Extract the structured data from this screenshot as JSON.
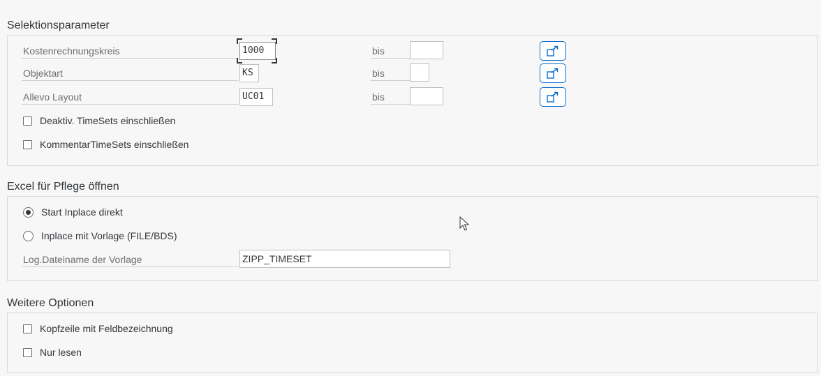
{
  "selection": {
    "title": "Selektionsparameter",
    "fields": [
      {
        "label": "Kostenrechnungskreis",
        "value": "1000",
        "bis": "bis",
        "to_value": ""
      },
      {
        "label": "Objektart",
        "value": "KS",
        "bis": "bis",
        "to_value": ""
      },
      {
        "label": "Allevo Layout",
        "value": "UC01",
        "bis": "bis",
        "to_value": ""
      }
    ],
    "checkboxes": [
      {
        "label": "Deaktiv. TimeSets einschließen",
        "checked": false
      },
      {
        "label": "KommentarTimeSets einschließen",
        "checked": false
      }
    ],
    "multi_select_icon": "multiple-selection-icon"
  },
  "excel": {
    "title": "Excel für Pflege öffnen",
    "radios": [
      {
        "label": "Start Inplace direkt",
        "selected": true
      },
      {
        "label": "Inplace mit Vorlage (FILE/BDS)",
        "selected": false
      }
    ],
    "template_label": "Log.Dateiname der Vorlage",
    "template_value": "ZIPP_TIMESET"
  },
  "options": {
    "title": "Weitere Optionen",
    "checkboxes": [
      {
        "label": "Kopfzeile mit Feldbezeichnung",
        "checked": false
      },
      {
        "label": "Nur lesen",
        "checked": false
      }
    ]
  },
  "colors": {
    "accent": "#0a6ed1",
    "background": "#f7f7f7",
    "label": "#6a6d70"
  }
}
